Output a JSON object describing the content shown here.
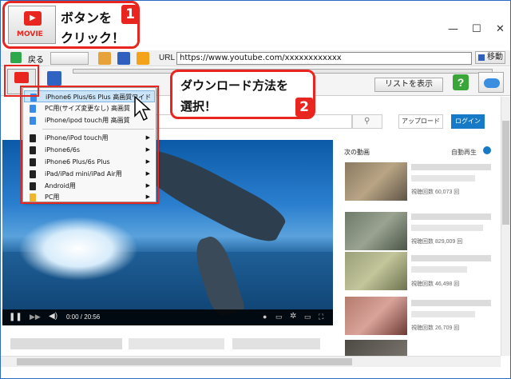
{
  "window": {
    "minimize": "—",
    "maximize": "☐",
    "close": "✕"
  },
  "toolbar": {
    "back_label": "戻る",
    "url_label": "URL",
    "url_value": "https://www.youtube.com/xxxxxxxxxxxx",
    "go_label": "移動",
    "list_button": "リストを表示"
  },
  "site": {
    "upload_button": "アップロード",
    "login_button": "ログイン",
    "next_videos": "次の動画",
    "autoplay": "自動再生",
    "time": "0:00 / 20:56",
    "views": [
      "視聴回数 60,073 回",
      "視聴回数 829,009 回",
      "視聴回数 46,498 回",
      "視聴回数 26,709 回"
    ]
  },
  "menu": {
    "items": [
      "iPhone6 Plus/6s Plus 高画質ワイド",
      "PC用(サイズ変更なし) 高画質",
      "iPhone/ipod touch用 高画質",
      "iPhone/iPod touch用",
      "iPhone6/6s",
      "iPhone6 Plus/6s Plus",
      "iPad/iPad mini/iPad Air用",
      "Android用",
      "PC用"
    ]
  },
  "callouts": {
    "one_line1": "ボタンを",
    "one_line2": "クリック！",
    "one_badge": "1",
    "two_line1": "ダウンロード方法を",
    "two_line2": "選択！",
    "two_badge": "2",
    "movie_label": "MOVIE"
  },
  "colors": {
    "accent_red": "#e8251f",
    "login_blue": "#167ac6"
  }
}
